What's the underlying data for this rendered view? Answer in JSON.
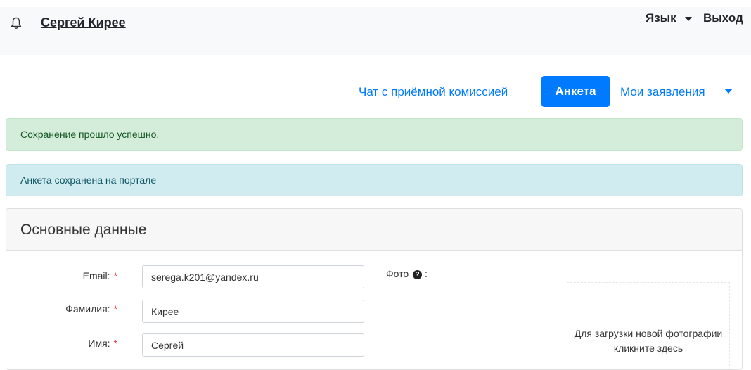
{
  "header": {
    "user_name": "Сергей Кирее",
    "language_label": "Язык",
    "logout_label": "Выход"
  },
  "nav": {
    "chat_label": "Чат с приёмной комиссией",
    "anketa_label": "Анкета",
    "applications_label": "Мои заявления"
  },
  "alerts": {
    "success": "Сохранение прошло успешно.",
    "info": "Анкета сохранена на портале"
  },
  "card": {
    "title": "Основные данные"
  },
  "form": {
    "email_label": "Email:",
    "email_value": "serega.k201@yandex.ru",
    "surname_label": "Фамилия:",
    "surname_value": "Кирее",
    "name_label": "Имя:",
    "name_value": "Сергей",
    "required_mark": "*"
  },
  "photo": {
    "label": "Фото",
    "label_suffix": ":",
    "help_glyph": "?",
    "upload_hint": "Для загрузки новой фотографии кликните здесь"
  },
  "icons": [
    "bell-icon",
    "caret-down-icon",
    "question-circle-icon"
  ],
  "colors": {
    "primary": "#007bff",
    "success_bg": "#d4edda",
    "info_bg": "#d1ecf1",
    "required": "#dc3545"
  }
}
